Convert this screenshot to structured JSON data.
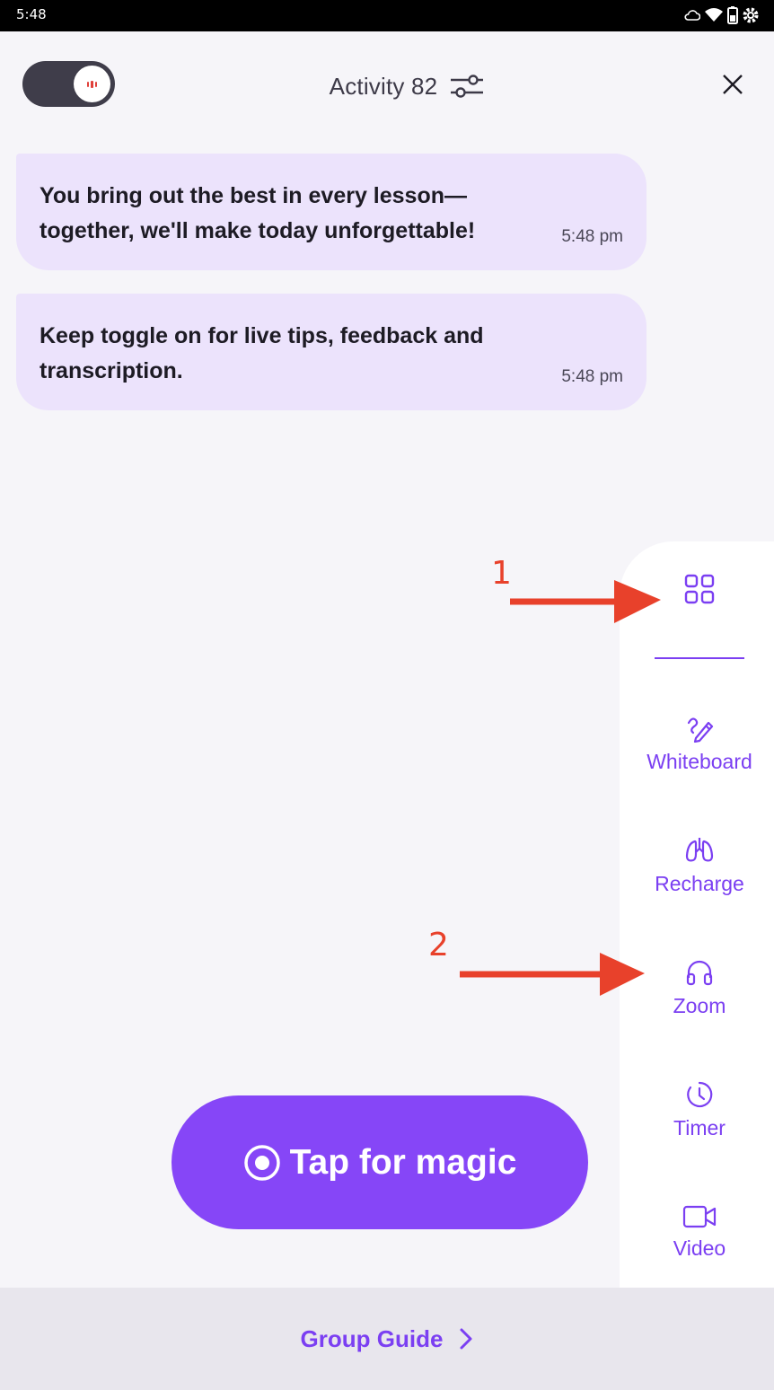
{
  "status_bar": {
    "time": "5:48",
    "icons": [
      "cloud-icon",
      "wifi-icon",
      "battery-icon",
      "settings-icon"
    ]
  },
  "header": {
    "title": "Activity 82",
    "toggle_state": "on",
    "icons": [
      "filter-sliders-icon",
      "close-icon"
    ]
  },
  "messages": [
    {
      "text": "You bring out the best in every lesson—together, we'll make today unforgettable!",
      "time": "5:48 pm"
    },
    {
      "text": "Keep toggle on for live tips, feedback and transcription.",
      "time": "5:48 pm"
    }
  ],
  "side_panel": {
    "items": [
      {
        "label": "",
        "icon": "grid-icon"
      },
      {
        "label": "Whiteboard",
        "icon": "pencil-squiggle-icon"
      },
      {
        "label": "Recharge",
        "icon": "lungs-icon"
      },
      {
        "label": "Zoom",
        "icon": "headphones-icon"
      },
      {
        "label": "Timer",
        "icon": "clock-icon"
      },
      {
        "label": "Video",
        "icon": "video-camera-icon"
      }
    ]
  },
  "annotations": [
    {
      "label": "1",
      "color": "#e8412b"
    },
    {
      "label": "2",
      "color": "#e8412b"
    }
  ],
  "primary_action": {
    "label": "Tap for magic",
    "icon": "record-icon"
  },
  "footer": {
    "link_label": "Group Guide",
    "icon": "chevron-right-icon"
  },
  "colors": {
    "accent": "#8646f7",
    "accent_text": "#7b3ff2",
    "bubble": "#ece3fc",
    "background": "#f6f5f9",
    "annotation": "#e8412b"
  }
}
